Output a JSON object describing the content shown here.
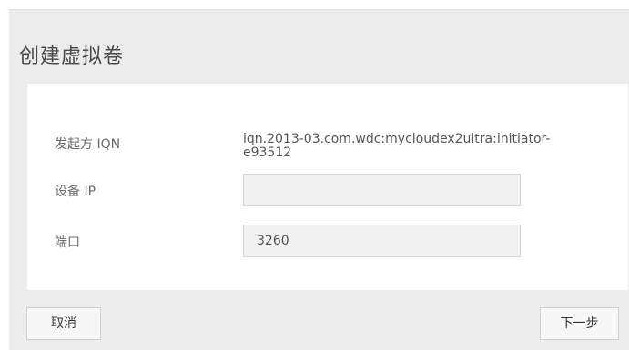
{
  "dialog": {
    "title": "创建虚拟卷"
  },
  "form": {
    "initiator_iqn": {
      "label": "发起方 IQN",
      "value": "iqn.2013-03.com.wdc:mycloudex2ultra:initiator-e93512"
    },
    "device_ip": {
      "label": "设备 IP",
      "value": ""
    },
    "port": {
      "label": "端口",
      "value": "3260"
    }
  },
  "buttons": {
    "cancel_label": "取消",
    "next_label": "下一步"
  }
}
